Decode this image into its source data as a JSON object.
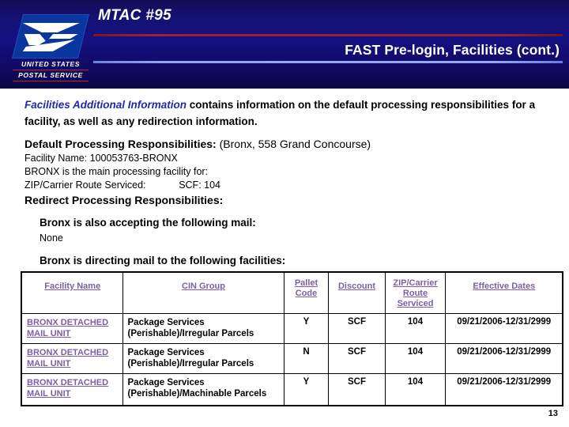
{
  "header": {
    "mtac_title": "MTAC #95",
    "subtitle": "FAST Pre-login, Facilities (cont.)",
    "logo": {
      "line1": "UNITED STATES",
      "line2": "POSTAL SERVICE",
      "mark_color": "#0a369e",
      "rule_color": "#b3252f"
    },
    "rule_red_color": "#9e1f2b",
    "rule_blue_color": "#97a4ef",
    "background_color": "#141080"
  },
  "intro": {
    "lead": "Facilities Additional Information",
    "rest": " contains information on the default processing responsibilities for a facility, as well as any redirection information."
  },
  "default_processing": {
    "heading": "Default Processing Responsibilities:",
    "heading_suffix": " (Bronx, 558 Grand Concourse)",
    "facility_name_line": "Facility Name: 100053763-BRONX",
    "main_facility_line": "BRONX is the main processing facility for:",
    "zip_route_line": "ZIP/Carrier Route Serviced:            SCF: 104",
    "redirect_heading": "Redirect Processing Responsibilities:"
  },
  "accepting": {
    "heading": "Bronx is also accepting the following mail:",
    "value": "None"
  },
  "directing": {
    "heading": "Bronx is directing mail to the following facilities:"
  },
  "table": {
    "columns": [
      "Facility Name",
      "CIN Group",
      "Pallet Code",
      "Discount",
      "ZIP/Carrier Route Serviced",
      "Effective Dates"
    ],
    "link_color": "#7b5ea7",
    "rows": [
      {
        "facility_name": "BRONX DETACHED MAIL UNIT",
        "cin_group_line1": "Package Services",
        "cin_group_line2": "(Perishable)/Irregular Parcels",
        "pallet_code": "Y",
        "discount": "SCF",
        "zip_route": "104",
        "effective_dates": "09/21/2006-12/31/2999"
      },
      {
        "facility_name": "BRONX DETACHED MAIL UNIT",
        "cin_group_line1": "Package Services",
        "cin_group_line2": "(Perishable)/Irregular Parcels",
        "pallet_code": "N",
        "discount": "SCF",
        "zip_route": "104",
        "effective_dates": "09/21/2006-12/31/2999"
      },
      {
        "facility_name": "BRONX DETACHED MAIL UNIT",
        "cin_group_line1": "Package Services",
        "cin_group_line2": "(Perishable)/Machinable Parcels",
        "pallet_code": "Y",
        "discount": "SCF",
        "zip_route": "104",
        "effective_dates": "09/21/2006-12/31/2999"
      }
    ]
  },
  "page_number": "13"
}
